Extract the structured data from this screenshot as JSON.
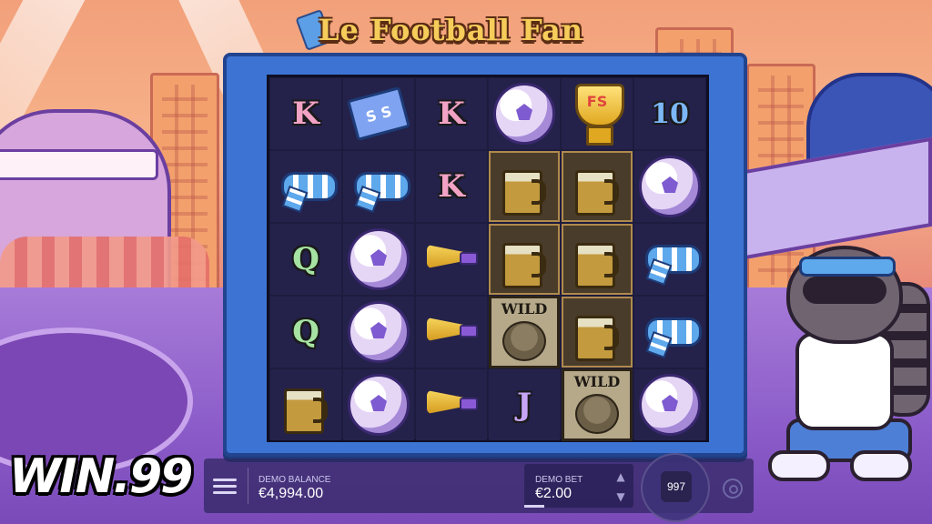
{
  "game": {
    "title": "Le Football Fan",
    "grid": [
      [
        {
          "type": "letter",
          "label": "K",
          "cls": "K"
        },
        {
          "type": "ticket",
          "label": "S S"
        },
        {
          "type": "letter",
          "label": "K",
          "cls": "K"
        },
        {
          "type": "ball"
        },
        {
          "type": "trophy",
          "label": "FS"
        },
        {
          "type": "letter",
          "label": "10",
          "cls": "T"
        }
      ],
      [
        {
          "type": "scarf"
        },
        {
          "type": "scarf"
        },
        {
          "type": "letter",
          "label": "K",
          "cls": "K"
        },
        {
          "type": "beer",
          "hl": true
        },
        {
          "type": "beer",
          "hl": true
        },
        {
          "type": "ball"
        }
      ],
      [
        {
          "type": "letter",
          "label": "Q",
          "cls": "Q"
        },
        {
          "type": "ball"
        },
        {
          "type": "horn"
        },
        {
          "type": "beer",
          "hl": true
        },
        {
          "type": "beer",
          "hl": true
        },
        {
          "type": "scarf"
        }
      ],
      [
        {
          "type": "letter",
          "label": "Q",
          "cls": "Q"
        },
        {
          "type": "ball"
        },
        {
          "type": "horn"
        },
        {
          "type": "wild",
          "label": "WILD",
          "hl": true
        },
        {
          "type": "beer",
          "hl": true
        },
        {
          "type": "scarf"
        }
      ],
      [
        {
          "type": "beer"
        },
        {
          "type": "ball"
        },
        {
          "type": "horn"
        },
        {
          "type": "letter",
          "label": "J",
          "cls": "J"
        },
        {
          "type": "wild",
          "label": "WILD",
          "hl": true
        },
        {
          "type": "ball"
        }
      ]
    ]
  },
  "logo": {
    "text": "WIN.99"
  },
  "bottom_bar": {
    "balance_label": "DEMO BALANCE",
    "balance_value": "€4,994.00",
    "bet_label": "DEMO BET",
    "bet_value": "€2.00",
    "spin_count": "997"
  },
  "icons": {
    "menu": "hamburger-menu-icon",
    "bet_up": "chevron-up-icon",
    "bet_down": "chevron-down-icon",
    "autoplay": "autoplay-icon"
  }
}
